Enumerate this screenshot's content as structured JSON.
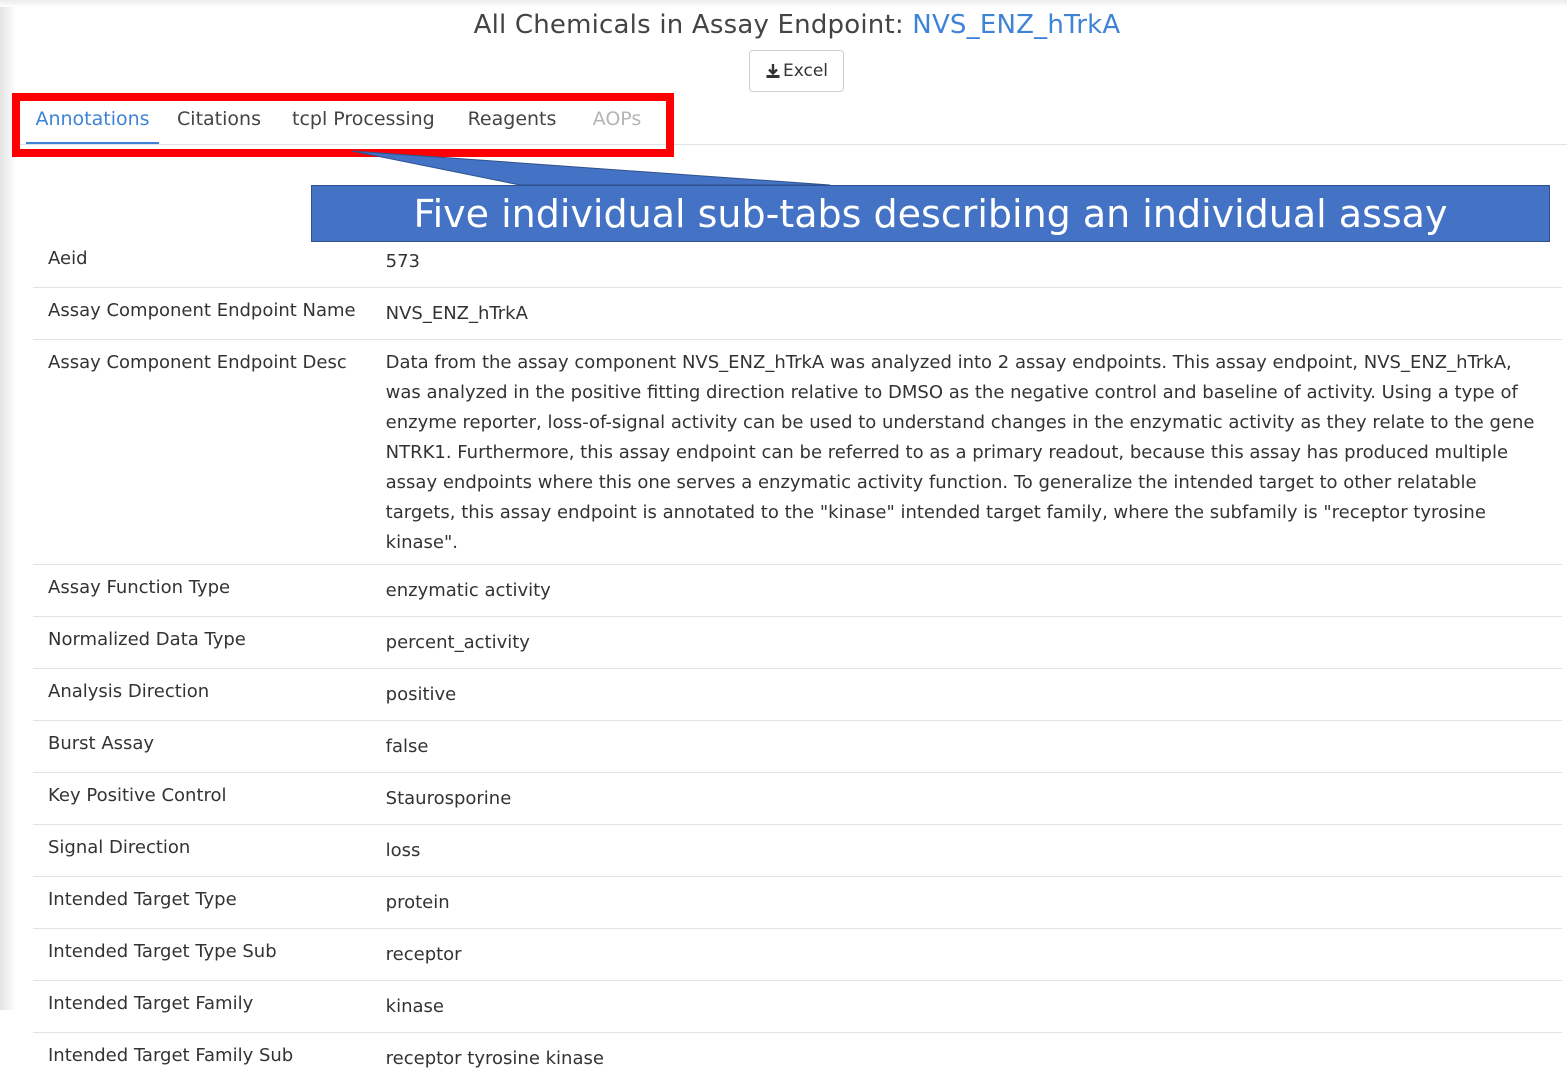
{
  "header": {
    "title_prefix": "All Chemicals in Assay Endpoint: ",
    "endpoint_name": "NVS_ENZ_hTrkA",
    "excel_button_label": "Excel",
    "excel_icon": "download-icon"
  },
  "tabs": [
    {
      "label": "Annotations",
      "state": "active"
    },
    {
      "label": "Citations",
      "state": "normal"
    },
    {
      "label": "tcpl Processing",
      "state": "normal"
    },
    {
      "label": "Reagents",
      "state": "normal"
    },
    {
      "label": "AOPs",
      "state": "disabled"
    }
  ],
  "callout": {
    "text": "Five individual sub-tabs describing an individual assay",
    "highlight_color": "#ff0000",
    "fill_color": "#4472c4"
  },
  "annotations": [
    {
      "label": "Aeid",
      "value": "573"
    },
    {
      "label": "Assay Component Endpoint Name",
      "value": "NVS_ENZ_hTrkA"
    },
    {
      "label": "Assay Component Endpoint Desc",
      "value": "Data from the assay component NVS_ENZ_hTrkA was analyzed into 2 assay endpoints. This assay endpoint, NVS_ENZ_hTrkA, was analyzed in the positive fitting direction relative to DMSO as the negative control and baseline of activity. Using a type of enzyme reporter, loss-of-signal activity can be used to understand changes in the enzymatic activity as they relate to the gene NTRK1. Furthermore, this assay endpoint can be referred to as a primary readout, because this assay has produced multiple assay endpoints where this one serves a enzymatic activity function. To generalize the intended target to other relatable targets, this assay endpoint is annotated to the \"kinase\" intended target family, where the subfamily is \"receptor tyrosine kinase\"."
    },
    {
      "label": "Assay Function Type",
      "value": "enzymatic activity"
    },
    {
      "label": "Normalized Data Type",
      "value": "percent_activity"
    },
    {
      "label": "Analysis Direction",
      "value": "positive"
    },
    {
      "label": "Burst Assay",
      "value": "false"
    },
    {
      "label": "Key Positive Control",
      "value": "Staurosporine"
    },
    {
      "label": "Signal Direction",
      "value": "loss"
    },
    {
      "label": "Intended Target Type",
      "value": "protein"
    },
    {
      "label": "Intended Target Type Sub",
      "value": "receptor"
    },
    {
      "label": "Intended Target Family",
      "value": "kinase"
    },
    {
      "label": "Intended Target Family Sub",
      "value": "receptor tyrosine kinase"
    }
  ],
  "colors": {
    "link_blue": "#3f83d6",
    "callout_blue": "#4472c4",
    "highlight_red": "#ff0000"
  }
}
